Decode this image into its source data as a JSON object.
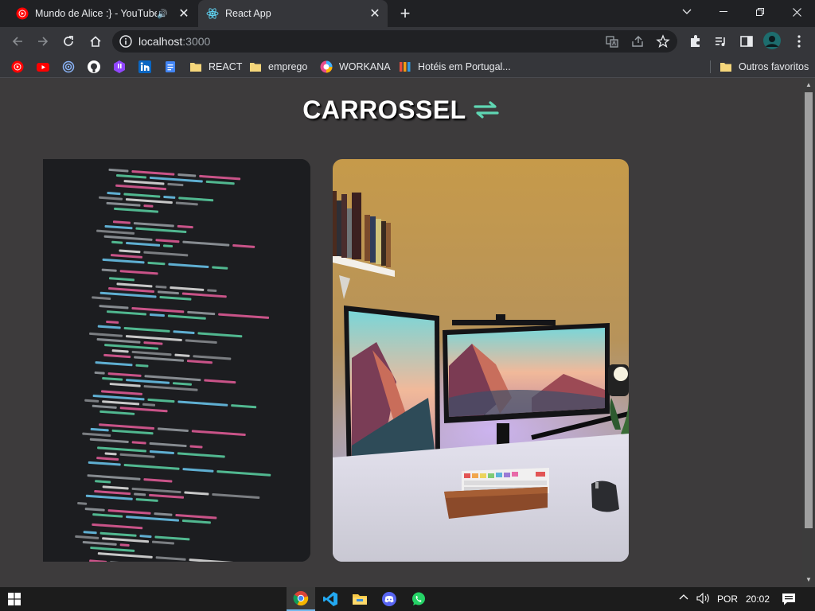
{
  "tabs": [
    {
      "title": "Mundo de Alice :} - YouTube",
      "active": false
    },
    {
      "title": "React App",
      "active": true
    }
  ],
  "address": {
    "host": "localhost",
    "port": ":3000"
  },
  "bookmarks": [
    {
      "label": "REACT"
    },
    {
      "label": "emprego"
    },
    {
      "label": "WORKANA"
    },
    {
      "label": "Hotéis em Portugal..."
    },
    {
      "label": "Outros favoritos"
    }
  ],
  "page": {
    "heading": "CARROSSEL",
    "accent": "#5fd6b3"
  },
  "taskbar": {
    "lang": "POR",
    "time": "20:02"
  }
}
